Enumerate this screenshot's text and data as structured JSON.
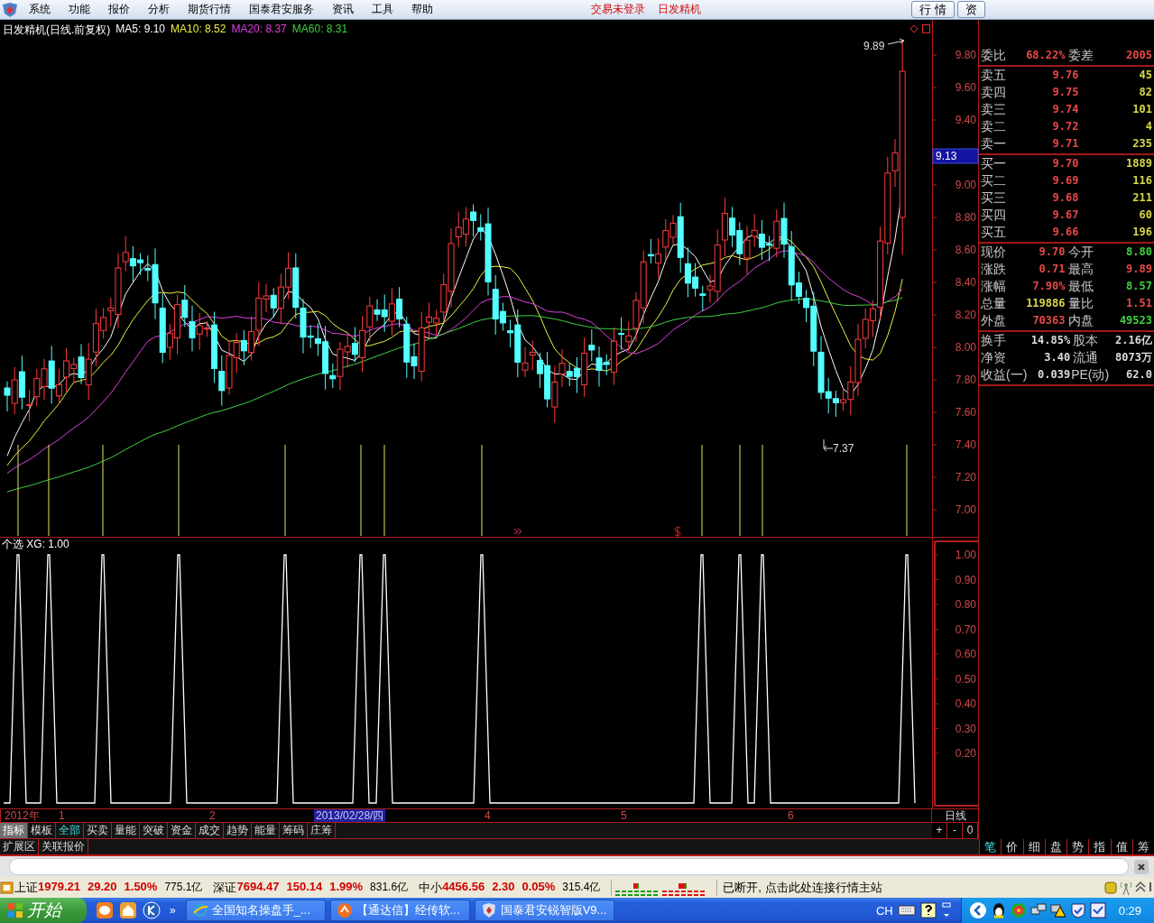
{
  "menu": {
    "items": [
      "系统",
      "功能",
      "报价",
      "分析",
      "期货行情",
      "国泰君安服务",
      "资讯",
      "工具",
      "帮助"
    ],
    "notices": [
      "交易未登录",
      "日发精机"
    ],
    "buttons": [
      "行 情",
      "资"
    ]
  },
  "chart": {
    "title": "日发精机(日线.前复权)",
    "moving_averages": [
      {
        "label": "MA5: 9.10",
        "color": "#ffffff"
      },
      {
        "label": "MA10: 8.52",
        "color": "#f0f040"
      },
      {
        "label": "MA20: 8.37",
        "color": "#e040e0"
      },
      {
        "label": "MA60: 8.31",
        "color": "#40d040"
      }
    ],
    "y_labels": [
      "9.80",
      "9.60",
      "9.40",
      "9.00",
      "8.80",
      "8.60",
      "8.40",
      "8.20",
      "8.00",
      "7.80",
      "7.60",
      "7.40",
      "7.20",
      "7.00"
    ],
    "price_tag": "9.13",
    "high_label": "9.89",
    "low_label": "7.37"
  },
  "indicator": {
    "title": "个选  XG: 1.00",
    "y_labels": [
      "1.00",
      "0.90",
      "0.80",
      "0.70",
      "0.60",
      "0.50",
      "0.40",
      "0.30",
      "0.20"
    ]
  },
  "date_axis": [
    {
      "label": "2012年",
      "selected": false
    },
    {
      "label": "1",
      "selected": false
    },
    {
      "label": "2",
      "selected": false
    },
    {
      "label": "2013/02/28/四",
      "selected": true
    },
    {
      "label": "4",
      "selected": false
    },
    {
      "label": "5",
      "selected": false
    },
    {
      "label": "6",
      "selected": false
    }
  ],
  "period": "日线",
  "panel_tabs": [
    {
      "label": "指标",
      "selected": true
    },
    {
      "label": "模板",
      "selected": false
    }
  ],
  "indicator_tabs": [
    {
      "label": "全部",
      "selected": true
    },
    {
      "label": "买卖",
      "selected": false
    },
    {
      "label": "量能",
      "selected": false
    },
    {
      "label": "突破",
      "selected": false
    },
    {
      "label": "资金",
      "selected": false
    },
    {
      "label": "成交",
      "selected": false
    },
    {
      "label": "趋势",
      "selected": false
    },
    {
      "label": "能量",
      "selected": false
    },
    {
      "label": "筹码",
      "selected": false
    },
    {
      "label": "庄筹",
      "selected": false
    }
  ],
  "zoom_buttons": [
    "+",
    "-",
    "0"
  ],
  "extra_tabs": [
    "扩展区",
    "关联报价"
  ],
  "detail_tabs": [
    {
      "label": "笔",
      "selected": true
    },
    {
      "label": "价",
      "selected": false
    },
    {
      "label": "细",
      "selected": false
    },
    {
      "label": "盘",
      "selected": false
    },
    {
      "label": "势",
      "selected": false
    },
    {
      "label": "指",
      "selected": false
    },
    {
      "label": "值",
      "selected": false
    },
    {
      "label": "筹",
      "selected": false
    }
  ],
  "quote": {
    "order_ratio": {
      "label": "委比",
      "value": "68.22%",
      "diff_label": "委差",
      "diff": "2005"
    },
    "asks": [
      {
        "label": "卖五",
        "price": "9.76",
        "volume": "45"
      },
      {
        "label": "卖四",
        "price": "9.75",
        "volume": "82"
      },
      {
        "label": "卖三",
        "price": "9.74",
        "volume": "101"
      },
      {
        "label": "卖二",
        "price": "9.72",
        "volume": "4"
      },
      {
        "label": "卖一",
        "price": "9.71",
        "volume": "235"
      }
    ],
    "bids": [
      {
        "label": "买一",
        "price": "9.70",
        "volume": "1889"
      },
      {
        "label": "买二",
        "price": "9.69",
        "volume": "116"
      },
      {
        "label": "买三",
        "price": "9.68",
        "volume": "211"
      },
      {
        "label": "买四",
        "price": "9.67",
        "volume": "60"
      },
      {
        "label": "买五",
        "price": "9.66",
        "volume": "196"
      }
    ],
    "stats": [
      {
        "label": "现价",
        "value": "9.70",
        "color": "#e84848"
      },
      {
        "label": "今开",
        "value": "8.80",
        "color": "#40d040"
      },
      {
        "label": "涨跌",
        "value": "0.71",
        "color": "#e84848"
      },
      {
        "label": "最高",
        "value": "9.89",
        "color": "#e84848"
      },
      {
        "label": "涨幅",
        "value": "7.90%",
        "color": "#e84848"
      },
      {
        "label": "最低",
        "value": "8.57",
        "color": "#40d040"
      },
      {
        "label": "总量",
        "value": "119886",
        "color": "#d8d84a"
      },
      {
        "label": "量比",
        "value": "1.51",
        "color": "#e84848"
      },
      {
        "label": "外盘",
        "value": "70363",
        "color": "#e84848"
      },
      {
        "label": "内盘",
        "value": "49523",
        "color": "#40d040"
      }
    ],
    "fundamentals": [
      {
        "label": "换手",
        "value": "14.85%"
      },
      {
        "label": "股本",
        "value": "2.16亿"
      },
      {
        "label": "净资",
        "value": "3.40"
      },
      {
        "label": "流通",
        "value": "8073万"
      },
      {
        "label": "收益(一)",
        "value": "0.039"
      },
      {
        "label": "PE(动)",
        "value": "62.0"
      }
    ]
  },
  "status_bar": {
    "indices": [
      {
        "name": "上证",
        "value": "1979.21",
        "change": "29.20",
        "percent": "1.50%",
        "amount": "775.1亿"
      },
      {
        "name": "深证",
        "value": "7694.47",
        "change": "150.14",
        "percent": "1.99%",
        "amount": "831.6亿"
      },
      {
        "name": "中小",
        "value": "4456.56",
        "change": "2.30",
        "percent": "0.05%",
        "amount": "315.4亿"
      }
    ],
    "message": "已断开, 点击此处连接行情主站"
  },
  "taskbar": {
    "start": "开始",
    "more": "»",
    "tasks": [
      "全国知名操盘手_...",
      "【通达信】经传软...",
      "国泰君安锐智版V9..."
    ],
    "ime": "CH",
    "clock": "0:29"
  }
}
